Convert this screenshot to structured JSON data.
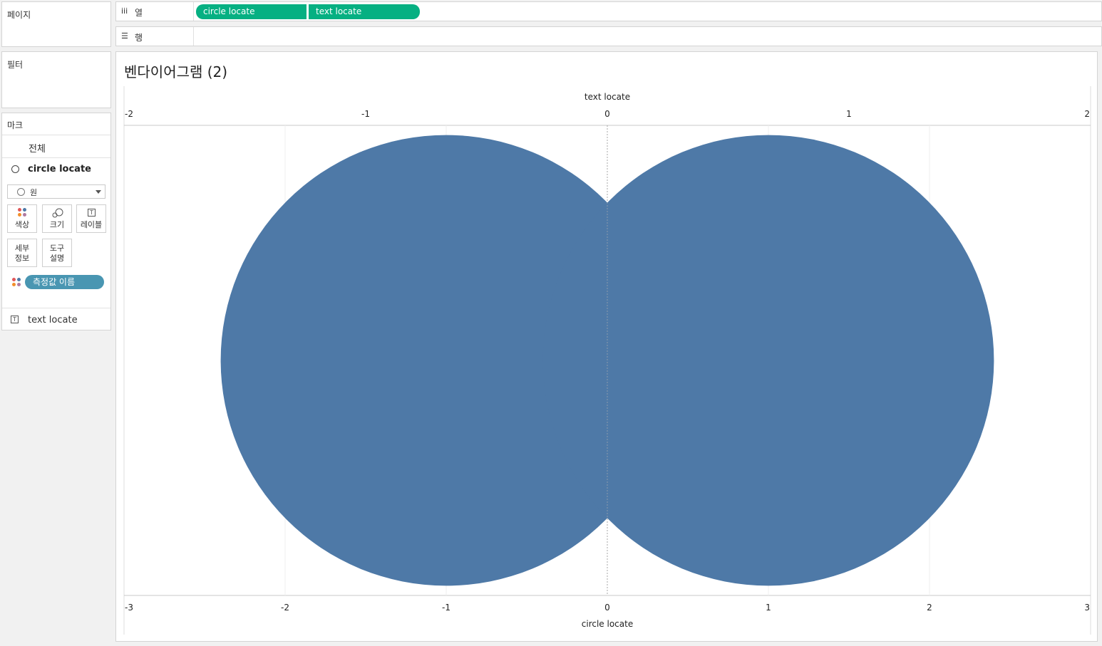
{
  "pages": {
    "title": "페이지"
  },
  "filters": {
    "title": "필터"
  },
  "marks": {
    "title": "마크",
    "all_label": "전체",
    "circle_label": "circle locate",
    "mark_type": "원",
    "buttons": {
      "color": "색상",
      "size": "크기",
      "label": "레이블",
      "detail": "세부\n정보",
      "tooltip": "도구\n설명"
    },
    "color_pill": "측정값 이름",
    "text_label": "text locate"
  },
  "shelves": {
    "columns_label": "열",
    "rows_label": "행",
    "column_pills": [
      "circle locate",
      "text locate"
    ]
  },
  "viz": {
    "title": "벤다이어그램 (2)"
  },
  "colors": {
    "circle_fill": "#4e79a7",
    "pill_green": "#06b082",
    "pill_blue": "#4996b2"
  },
  "chart_data": {
    "type": "scatter",
    "mark": "circle",
    "top_axis": {
      "label": "text locate",
      "ticks": [
        -2,
        -1,
        0,
        1,
        2
      ],
      "range": [
        -2,
        2
      ]
    },
    "bottom_axis": {
      "label": "circle locate",
      "ticks": [
        -3,
        -2,
        -1,
        0,
        1,
        2,
        3
      ],
      "range": [
        -3,
        3
      ]
    },
    "points": [
      {
        "x": -1,
        "y": 0
      },
      {
        "x": 1,
        "y": 0
      }
    ],
    "grid": true
  }
}
